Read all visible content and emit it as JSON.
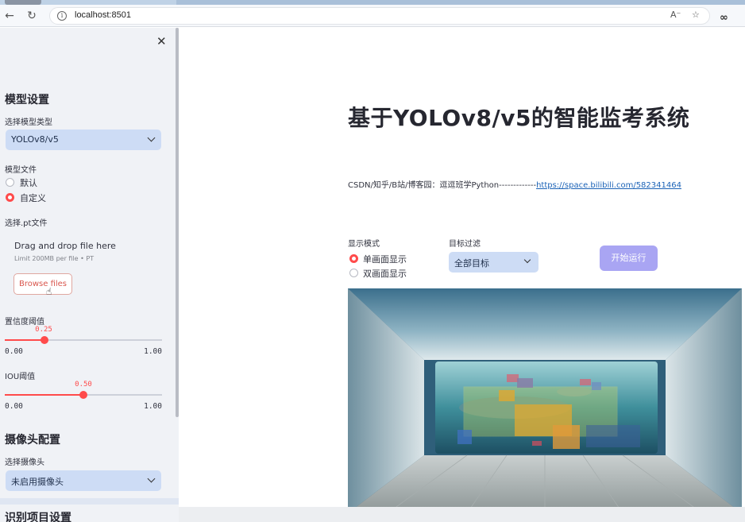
{
  "browser": {
    "url": "localhost:8501",
    "back_icon": "arrow-left-icon",
    "reload_icon": "reload-icon",
    "info_icon": "info-icon",
    "read_aloud_icon": "read-aloud-icon",
    "favorite_icon": "star-icon",
    "extension_icon": "infinity-icon"
  },
  "sidebar": {
    "close_icon": "close-icon",
    "model_settings_header": "模型设置",
    "model_type_label": "选择模型类型",
    "model_type_value": "YOLOv8/v5",
    "model_file_label": "模型文件",
    "model_file_options": [
      "默认",
      "自定义"
    ],
    "model_file_selected": "自定义",
    "pt_file_label": "选择.pt文件",
    "uploader": {
      "title": "Drag and drop file here",
      "limit": "Limit 200MB per file • PT",
      "button": "Browse files"
    },
    "confidence": {
      "label": "置信度阈值",
      "value": "0.25",
      "min": "0.00",
      "max": "1.00",
      "fraction": 0.25
    },
    "iou": {
      "label": "IOU阈值",
      "value": "0.50",
      "min": "0.00",
      "max": "1.00",
      "fraction": 0.5
    },
    "camera_header": "摄像头配置",
    "camera_label": "选择摄像头",
    "camera_value": "未启用摄像头",
    "recognition_header": "识别项目设置"
  },
  "main": {
    "title": "基于YOLOv8/v5的智能监考系统",
    "credit_text": "CSDN/知乎/B站/博客园：逗逗班学Python-------------",
    "credit_link": "https://space.bilibili.com/582341464",
    "display_mode_label": "显示模式",
    "display_mode_options": [
      "单画面显示",
      "双画面显示"
    ],
    "display_mode_selected": "单画面显示",
    "target_filter_label": "目标过滤",
    "target_filter_value": "全部目标",
    "run_button": "开始运行"
  },
  "colors": {
    "accent": "#ff4b4b",
    "select_bg": "#cddcf5",
    "sidebar_bg": "#f0f2f6",
    "run_button": "#a9a5f3",
    "link": "#1c63b7"
  }
}
